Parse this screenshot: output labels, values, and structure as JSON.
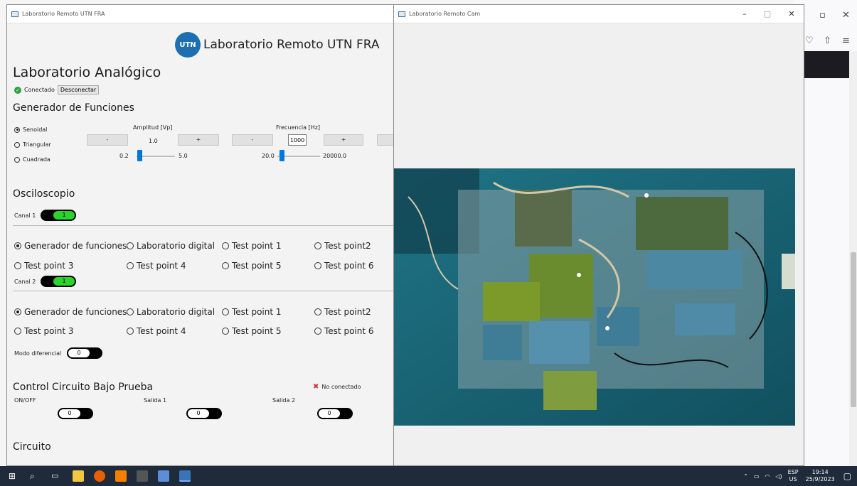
{
  "left_window": {
    "title": "Laboratorio Remoto UTN FRA",
    "logo_text": "UTN",
    "header_title": "Laboratorio Remoto UTN FRA",
    "lab_title": "Laboratorio Analógico",
    "status_connected": "Conectado",
    "disconnect_label": "Desconectar"
  },
  "generator": {
    "title": "Generador de Funciones",
    "waves": [
      "Senoidal",
      "Triangular",
      "Cuadrada"
    ],
    "selected_wave": "Senoidal",
    "amplitude": {
      "label": "Amplitud [Vp]",
      "minus": "-",
      "plus": "+",
      "value": "1.0",
      "min": "0.2",
      "max": "5.0",
      "slider_level": 0.02
    },
    "frequency": {
      "label": "Frecuencia [Hz]",
      "minus": "-",
      "plus": "+",
      "value": "1000",
      "min": "20.0",
      "max": "20000.0",
      "slider_level": 0.05
    }
  },
  "scope": {
    "title": "Osciloscopio",
    "channel1": {
      "label": "Canal 1",
      "toggle_text": "1",
      "on": true
    },
    "channel2": {
      "label": "Canal 2",
      "toggle_text": "1",
      "on": true
    },
    "options_row1": [
      "Generador de funciones",
      "Laboratorio digital",
      "Test point 1",
      "Test point2"
    ],
    "options_row2": [
      "Test point 3",
      "Test point 4",
      "Test point 5",
      "Test point 6"
    ],
    "ch1_selected": "Generador de funciones",
    "ch2_selected": "Generador de funciones",
    "diff_mode": {
      "label": "Modo diferencial",
      "toggle_text": "0",
      "on": false
    }
  },
  "cbp": {
    "title": "Control Circuito Bajo Prueba",
    "status": "No conectado",
    "onoff": {
      "label": "ON/OFF",
      "toggle_text": "0"
    },
    "out1": {
      "label": "Salida 1",
      "toggle_text": "0"
    },
    "out2": {
      "label": "Salida 2",
      "toggle_text": "0"
    }
  },
  "circuit": {
    "title": "Circuito"
  },
  "right_window": {
    "title": "Laboratorio Remoto Cam",
    "minimize": "–",
    "maximize": "□",
    "close": "✕"
  },
  "browser": {
    "restore": "▫",
    "close": "✕"
  },
  "tray": {
    "lang": "ESP",
    "layout": "US",
    "time": "19:14",
    "date": "25/9/2023"
  },
  "colors": {
    "accent": "#0078d7",
    "toggle_on": "#2bd42b",
    "ok": "#2ea043",
    "error": "#d13438"
  }
}
